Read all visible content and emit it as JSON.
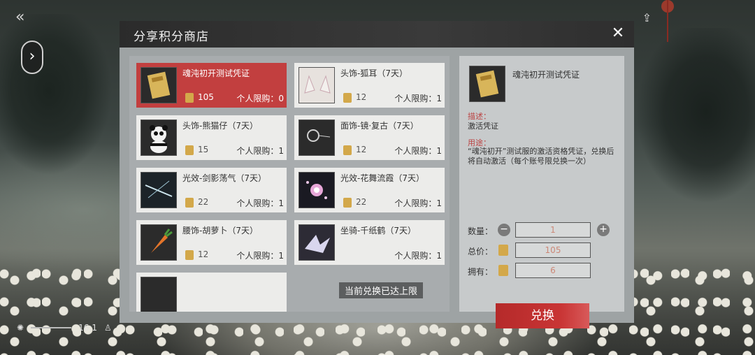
{
  "modal": {
    "title": "分享积分商店"
  },
  "items": [
    {
      "name": "魂沌初开测试凭证",
      "price": "105",
      "limit": "个人限购：0",
      "selected": true
    },
    {
      "name": "头饰-狐耳（7天）",
      "price": "12",
      "limit": "个人限购：1"
    },
    {
      "name": "头饰-熊猫仔（7天）",
      "price": "15",
      "limit": "个人限购：1"
    },
    {
      "name": "面饰-镜·复古（7天）",
      "price": "12",
      "limit": "个人限购：1"
    },
    {
      "name": "光效-剑影荡气（7天）",
      "price": "22",
      "limit": "个人限购：1"
    },
    {
      "name": "光效-花舞流霞（7天）",
      "price": "22",
      "limit": "个人限购：1"
    },
    {
      "name": "腰饰-胡萝卜（7天）",
      "price": "12",
      "limit": "个人限购：1"
    },
    {
      "name": "坐骑-千纸鹤（7天）",
      "price": "",
      "limit": "个人限购：1"
    }
  ],
  "toast": "当前兑换已达上限",
  "detail": {
    "name": "魂沌初开测试凭证",
    "desc_label": "描述：",
    "desc": "激活凭证",
    "use_label": "用途：",
    "use": "“魂沌初开”测试服的激活资格凭证，兑换后将自动激活（每个账号限兑换一次）",
    "qty_label": "数量：",
    "qty": "1",
    "total_label": "总价：",
    "total": "105",
    "own_label": "拥有：",
    "own": "6",
    "exchange_label": "兑换"
  },
  "hud": {
    "time": "16:1"
  },
  "colors": {
    "selected": "#c23f3f",
    "button": "#c93535",
    "coin": "#d3a84a"
  }
}
